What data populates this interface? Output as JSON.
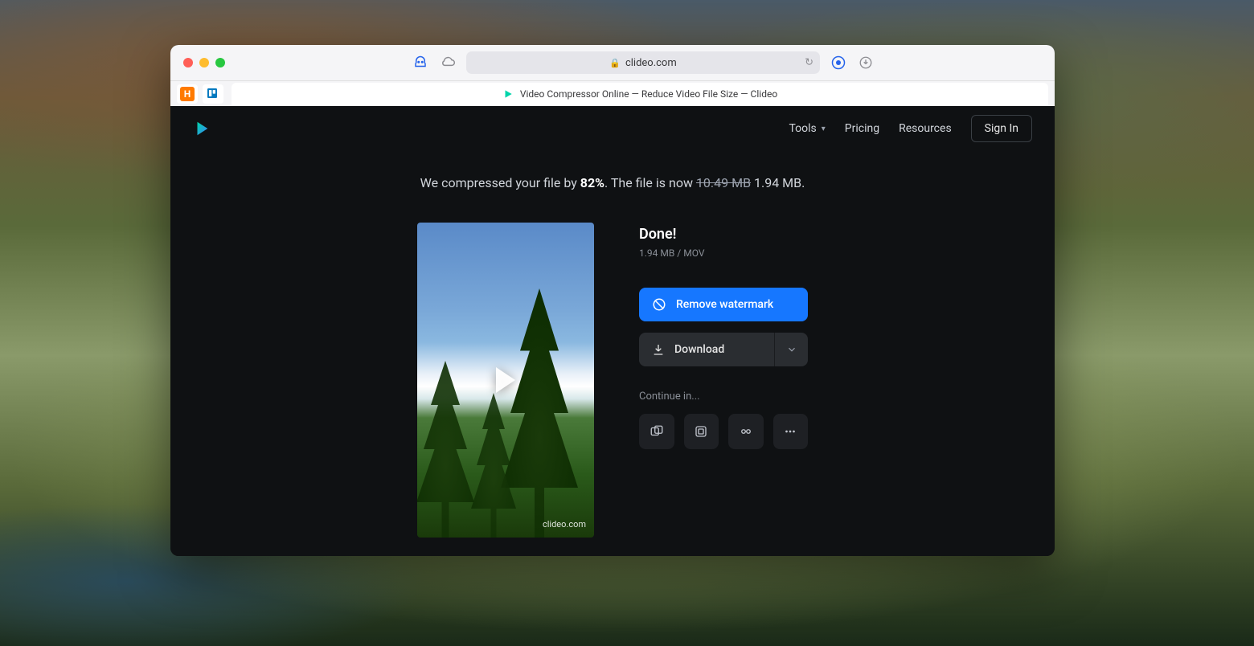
{
  "browser": {
    "address": "clideo.com",
    "tab_title": "Video Compressor Online — Reduce Video File Size — Clideo"
  },
  "nav": {
    "tools": "Tools",
    "pricing": "Pricing",
    "resources": "Resources",
    "signin": "Sign In"
  },
  "summary": {
    "prefix": "We compressed your file by ",
    "percent": "82%",
    "mid": ". The file is now ",
    "old_size": "10.49 MB",
    "new_size": " 1.94 MB."
  },
  "result": {
    "done": "Done!",
    "size": "1.94 MB",
    "sep": "  /  ",
    "format": "MOV",
    "watermark_site": "clideo.com",
    "remove_watermark": "Remove watermark",
    "download": "Download",
    "continue_label": "Continue in..."
  }
}
